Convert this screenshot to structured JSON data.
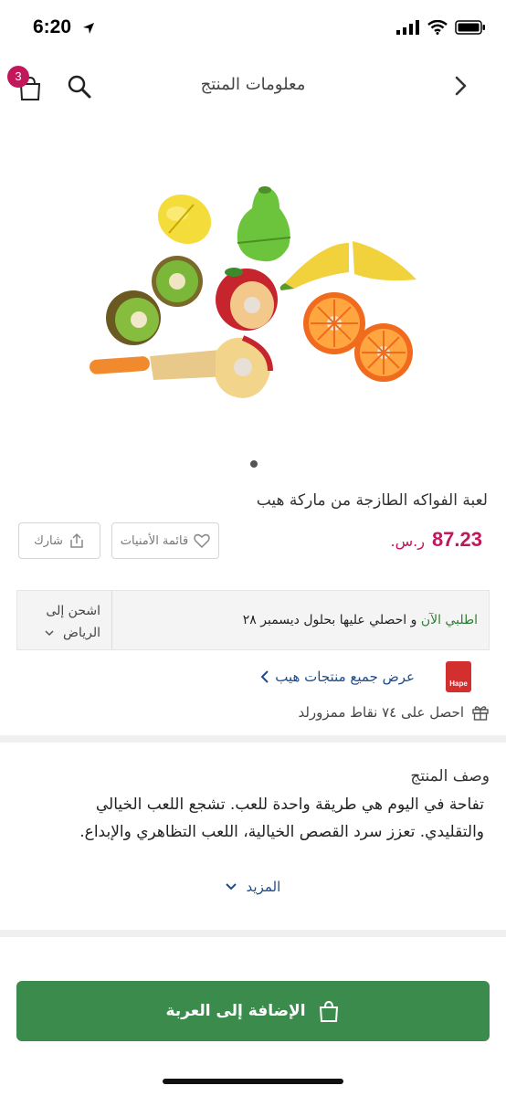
{
  "status": {
    "time": "6:20"
  },
  "nav": {
    "title": "معلومات المنتج",
    "cart_count": "3"
  },
  "product": {
    "title": "لعبة الفواكه الطازجة من ماركة هيب",
    "price": "87.23",
    "currency": "ر.س.",
    "wishlist_label": "قائمة الأمنيات",
    "share_label": "شارك"
  },
  "shipping": {
    "ship_to_label": "اشحن إلى",
    "city": "الرياض",
    "order_now": "اطلبي الآن",
    "delivery_text": " و احصلي عليها بحلول ديسمبر ٢٨"
  },
  "brand": {
    "logo_text": "Hape",
    "view_all": "عرض جميع منتجات هيب",
    "points": "احصل على ٧٤ نقاط ممزورلد"
  },
  "description": {
    "title": "وصف المنتج",
    "body": "تفاحة في اليوم هي طريقة واحدة للعب. تشجع اللعب الخيالي والتقليدي. تعزز سرد القصص الخيالية، اللعب التظاهري والإبداع.",
    "more": "المزيد"
  },
  "cta": {
    "add_to_cart": "الإضافة إلى العربة"
  },
  "colors": {
    "accent": "#c2185b",
    "primary_green": "#3a8b4c",
    "link": "#1e4b8a"
  }
}
